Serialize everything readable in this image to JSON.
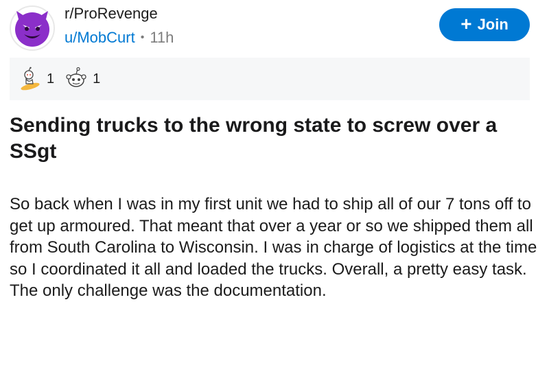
{
  "post": {
    "subreddit": "r/ProRevenge",
    "username": "u/MobCurt",
    "separator": "•",
    "time": "11h",
    "join_label": "Join",
    "awards": [
      {
        "name": "surfing-snoo-award",
        "count": "1"
      },
      {
        "name": "snoo-face-award",
        "count": "1"
      }
    ],
    "title": "Sending trucks to the wrong state to screw over a SSgt",
    "body": "So back when I was in my first unit we had to ship all of our 7 tons off to get up armoured. That meant that over a year or so we shipped them all from South Carolina to Wisconsin. I was in charge of logistics at the time so I coordinated it all and loaded the trucks. Overall, a pretty easy task. The only challenge was the documentation."
  },
  "colors": {
    "accent": "#0079d3",
    "avatar": "#8b2fc9",
    "award_bg": "#f6f7f8"
  },
  "icons": {
    "avatar": "devil-face-icon",
    "join": "plus-icon"
  }
}
